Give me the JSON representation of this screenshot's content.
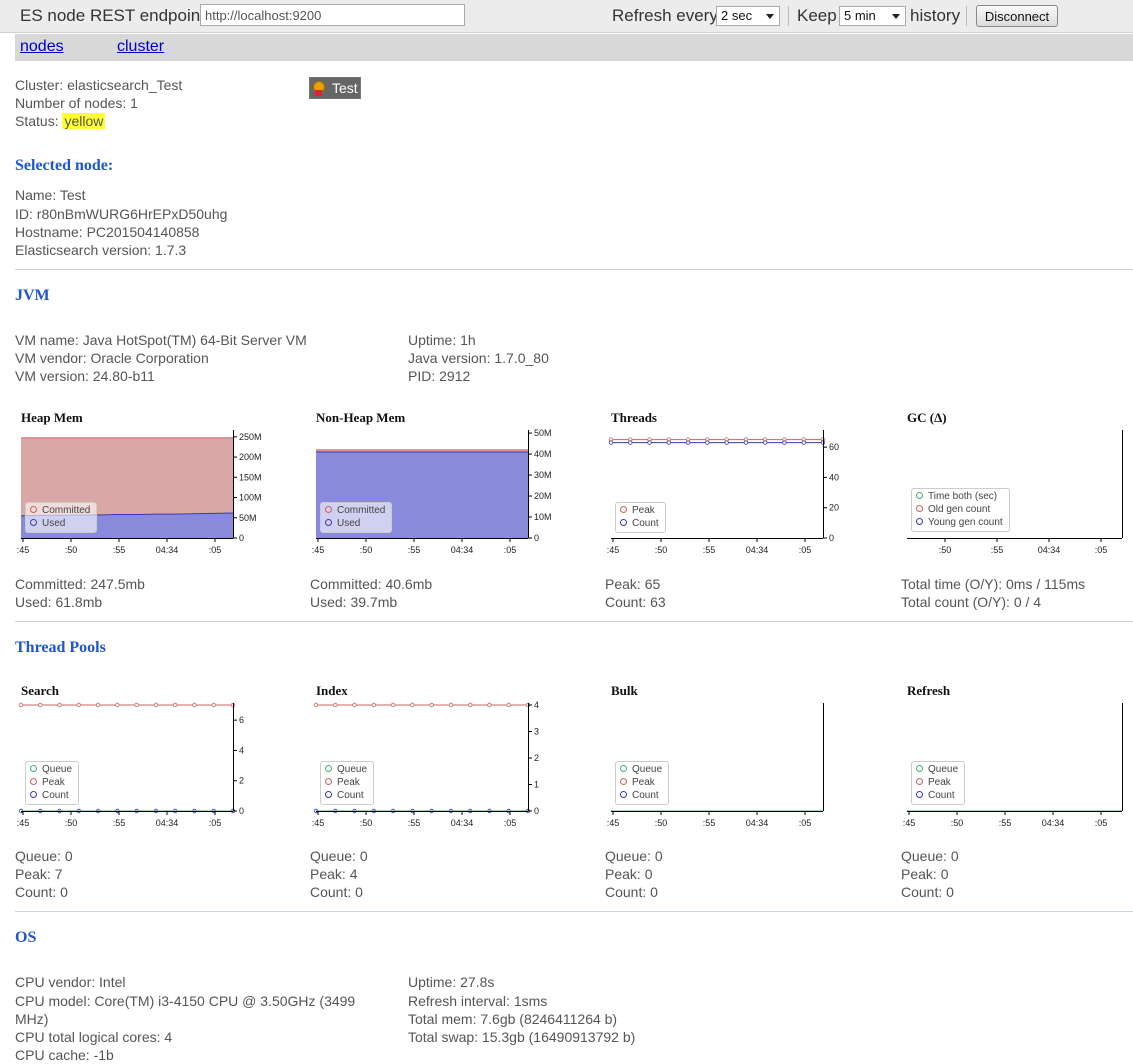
{
  "topbar": {
    "endpoint_label": "ES node REST endpoint",
    "endpoint_value": "http://localhost:9200",
    "refresh_label": "Refresh every",
    "refresh_value": "2 sec",
    "keep_label": "Keep",
    "keep_value": "5 min",
    "history_label": "history",
    "disconnect_label": "Disconnect"
  },
  "nav": {
    "nodes": "nodes",
    "cluster": "cluster"
  },
  "cluster": {
    "name": "Cluster: elasticsearch_Test",
    "nodes": "Number of nodes: 1",
    "status_label": "Status:",
    "status_value": "yellow",
    "node_badge": "Test"
  },
  "selected_node": {
    "header": "Selected node:",
    "name": "Name: Test",
    "id": "ID: r80nBmWURG6HrEPxD50uhg",
    "hostname": "Hostname: PC201504140858",
    "es_version": "Elasticsearch version: 1.7.3"
  },
  "jvm": {
    "header": "JVM",
    "vm_name": "VM name: Java HotSpot(TM) 64-Bit Server VM",
    "vm_vendor": "VM vendor: Oracle Corporation",
    "vm_version": "VM version: 24.80-b11",
    "uptime": "Uptime: 1h",
    "java_version": "Java version: 1.7.0_80",
    "pid": "PID: 2912",
    "heap_committed": "Committed: 247.5mb",
    "heap_used": "Used: 61.8mb",
    "nonheap_committed": "Committed: 40.6mb",
    "nonheap_used": "Used: 39.7mb",
    "threads_peak": "Peak: 65",
    "threads_count": "Count: 63",
    "gc_time": "Total time (O/Y): 0ms / 115ms",
    "gc_count": "Total count (O/Y): 0 / 4"
  },
  "thread_pools": {
    "header": "Thread Pools",
    "search": {
      "queue": "Queue: 0",
      "peak": "Peak: 7",
      "count": "Count: 0"
    },
    "index": {
      "queue": "Queue: 0",
      "peak": "Peak: 4",
      "count": "Count: 0"
    },
    "bulk": {
      "queue": "Queue: 0",
      "peak": "Peak: 0",
      "count": "Count: 0"
    },
    "refresh": {
      "queue": "Queue: 0",
      "peak": "Peak: 0",
      "count": "Count: 0"
    }
  },
  "os": {
    "header": "OS",
    "cpu_vendor": "CPU vendor: Intel",
    "cpu_model_1": "CPU model: Core(TM) i3-4150 CPU @ 3.50GHz (3499",
    "cpu_model_2": "MHz)",
    "cpu_cores": "CPU total logical cores: 4",
    "cpu_cache": "CPU cache: -1b",
    "uptime": "Uptime: 27.8s",
    "refresh_interval": "Refresh interval: 1sms",
    "total_mem": "Total mem: 7.6gb (8246411264 b)",
    "total_swap": "Total swap: 15.3gb (16490913792 b)"
  },
  "colors": {
    "committed": "#d9a8a6",
    "used": "#8a8add",
    "peak": "#d06060",
    "count": "#3a3ab0",
    "queue": "#40b070",
    "accent": "#1e56d0"
  },
  "chart_data": [
    {
      "type": "area",
      "title": "Heap Mem",
      "x_ticks": [
        ":45",
        ":50",
        ":55",
        "04:34",
        ":05"
      ],
      "y_ticks": [
        "250M",
        "200M",
        "150M",
        "100M",
        "50M",
        "0"
      ],
      "ylim": [
        0,
        262
      ],
      "series": [
        {
          "name": "Committed",
          "values": [
            247.5,
            247.5,
            247.5,
            247.5,
            247.5,
            247.5,
            247.5,
            247.5,
            247.5,
            247.5,
            247.5,
            247.5
          ]
        },
        {
          "name": "Used",
          "values": [
            55,
            56,
            56,
            57,
            57,
            58,
            58,
            59,
            59,
            60,
            61,
            61.8
          ]
        }
      ],
      "legend": [
        "Committed",
        "Used"
      ]
    },
    {
      "type": "area",
      "title": "Non-Heap Mem",
      "x_ticks": [
        ":45",
        ":50",
        ":55",
        "04:34",
        ":05"
      ],
      "y_ticks": [
        "50M",
        "40M",
        "30M",
        "20M",
        "10M",
        "0"
      ],
      "ylim": [
        0,
        50.5
      ],
      "series": [
        {
          "name": "Committed",
          "values": [
            42,
            42,
            42,
            42,
            42,
            42,
            42,
            42,
            42,
            42,
            42,
            42
          ]
        },
        {
          "name": "Used",
          "values": [
            41,
            41,
            41,
            41,
            41,
            41,
            41,
            41,
            41,
            41,
            41,
            41
          ]
        }
      ],
      "legend": [
        "Committed",
        "Used"
      ]
    },
    {
      "type": "line",
      "title": "Threads",
      "x_ticks": [
        ":45",
        ":50",
        ":55",
        "04:34",
        ":05"
      ],
      "y_ticks": [
        "60",
        "40",
        "20",
        "0"
      ],
      "ylim": [
        0,
        70
      ],
      "series": [
        {
          "name": "Peak",
          "values": [
            65,
            65,
            65,
            65,
            65,
            65,
            65,
            65,
            65,
            65,
            65,
            65
          ]
        },
        {
          "name": "Count",
          "values": [
            63,
            63,
            63,
            63,
            63,
            63,
            63,
            63,
            63,
            63,
            63,
            63
          ]
        }
      ],
      "legend": [
        "Peak",
        "Count"
      ]
    },
    {
      "type": "line",
      "title": "GC (Δ)",
      "x_ticks": [
        ":50",
        ":55",
        "04:34",
        ":05"
      ],
      "y_ticks": [],
      "series": [],
      "legend": [
        "Time both (sec)",
        "Old gen count",
        "Young gen count"
      ]
    },
    {
      "type": "line",
      "title": "Search",
      "x_ticks": [
        ":45",
        ":50",
        ":55",
        "04:34",
        ":05"
      ],
      "y_ticks": [
        "6",
        "4",
        "2",
        "0"
      ],
      "ylim": [
        0,
        7
      ],
      "series": [
        {
          "name": "Peak",
          "values": [
            7,
            7,
            7,
            7,
            7,
            7,
            7,
            7,
            7,
            7,
            7,
            7
          ]
        },
        {
          "name": "Count",
          "values": [
            0,
            0,
            0,
            0,
            0,
            0,
            0,
            0,
            0,
            0,
            0,
            0
          ]
        }
      ],
      "legend": [
        "Queue",
        "Peak",
        "Count"
      ]
    },
    {
      "type": "line",
      "title": "Index",
      "x_ticks": [
        ":45",
        ":50",
        ":55",
        "04:34",
        ":05"
      ],
      "y_ticks": [
        "4",
        "3",
        "2",
        "1",
        "0"
      ],
      "ylim": [
        0,
        4
      ],
      "series": [
        {
          "name": "Peak",
          "values": [
            4,
            4,
            4,
            4,
            4,
            4,
            4,
            4,
            4,
            4,
            4,
            4
          ]
        },
        {
          "name": "Count",
          "values": [
            0,
            0,
            0,
            0,
            0,
            0,
            0,
            0,
            0,
            0,
            0,
            0
          ]
        }
      ],
      "legend": [
        "Queue",
        "Peak",
        "Count"
      ]
    },
    {
      "type": "line",
      "title": "Bulk",
      "x_ticks": [
        ":45",
        ":50",
        ":55",
        "04:34",
        ":05"
      ],
      "y_ticks": [],
      "series": [],
      "legend": [
        "Queue",
        "Peak",
        "Count"
      ]
    },
    {
      "type": "line",
      "title": "Refresh",
      "x_ticks": [
        ":45",
        ":50",
        ":55",
        "04:34",
        ":05"
      ],
      "y_ticks": [],
      "series": [],
      "legend": [
        "Queue",
        "Peak",
        "Count"
      ]
    }
  ]
}
